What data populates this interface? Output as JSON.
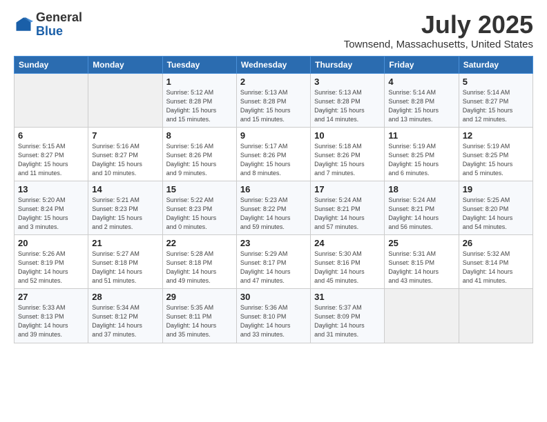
{
  "header": {
    "logo_general": "General",
    "logo_blue": "Blue",
    "month_year": "July 2025",
    "location": "Townsend, Massachusetts, United States"
  },
  "days_of_week": [
    "Sunday",
    "Monday",
    "Tuesday",
    "Wednesday",
    "Thursday",
    "Friday",
    "Saturday"
  ],
  "weeks": [
    [
      {
        "num": "",
        "info": ""
      },
      {
        "num": "",
        "info": ""
      },
      {
        "num": "1",
        "info": "Sunrise: 5:12 AM\nSunset: 8:28 PM\nDaylight: 15 hours\nand 15 minutes."
      },
      {
        "num": "2",
        "info": "Sunrise: 5:13 AM\nSunset: 8:28 PM\nDaylight: 15 hours\nand 15 minutes."
      },
      {
        "num": "3",
        "info": "Sunrise: 5:13 AM\nSunset: 8:28 PM\nDaylight: 15 hours\nand 14 minutes."
      },
      {
        "num": "4",
        "info": "Sunrise: 5:14 AM\nSunset: 8:28 PM\nDaylight: 15 hours\nand 13 minutes."
      },
      {
        "num": "5",
        "info": "Sunrise: 5:14 AM\nSunset: 8:27 PM\nDaylight: 15 hours\nand 12 minutes."
      }
    ],
    [
      {
        "num": "6",
        "info": "Sunrise: 5:15 AM\nSunset: 8:27 PM\nDaylight: 15 hours\nand 11 minutes."
      },
      {
        "num": "7",
        "info": "Sunrise: 5:16 AM\nSunset: 8:27 PM\nDaylight: 15 hours\nand 10 minutes."
      },
      {
        "num": "8",
        "info": "Sunrise: 5:16 AM\nSunset: 8:26 PM\nDaylight: 15 hours\nand 9 minutes."
      },
      {
        "num": "9",
        "info": "Sunrise: 5:17 AM\nSunset: 8:26 PM\nDaylight: 15 hours\nand 8 minutes."
      },
      {
        "num": "10",
        "info": "Sunrise: 5:18 AM\nSunset: 8:26 PM\nDaylight: 15 hours\nand 7 minutes."
      },
      {
        "num": "11",
        "info": "Sunrise: 5:19 AM\nSunset: 8:25 PM\nDaylight: 15 hours\nand 6 minutes."
      },
      {
        "num": "12",
        "info": "Sunrise: 5:19 AM\nSunset: 8:25 PM\nDaylight: 15 hours\nand 5 minutes."
      }
    ],
    [
      {
        "num": "13",
        "info": "Sunrise: 5:20 AM\nSunset: 8:24 PM\nDaylight: 15 hours\nand 3 minutes."
      },
      {
        "num": "14",
        "info": "Sunrise: 5:21 AM\nSunset: 8:23 PM\nDaylight: 15 hours\nand 2 minutes."
      },
      {
        "num": "15",
        "info": "Sunrise: 5:22 AM\nSunset: 8:23 PM\nDaylight: 15 hours\nand 0 minutes."
      },
      {
        "num": "16",
        "info": "Sunrise: 5:23 AM\nSunset: 8:22 PM\nDaylight: 14 hours\nand 59 minutes."
      },
      {
        "num": "17",
        "info": "Sunrise: 5:24 AM\nSunset: 8:21 PM\nDaylight: 14 hours\nand 57 minutes."
      },
      {
        "num": "18",
        "info": "Sunrise: 5:24 AM\nSunset: 8:21 PM\nDaylight: 14 hours\nand 56 minutes."
      },
      {
        "num": "19",
        "info": "Sunrise: 5:25 AM\nSunset: 8:20 PM\nDaylight: 14 hours\nand 54 minutes."
      }
    ],
    [
      {
        "num": "20",
        "info": "Sunrise: 5:26 AM\nSunset: 8:19 PM\nDaylight: 14 hours\nand 52 minutes."
      },
      {
        "num": "21",
        "info": "Sunrise: 5:27 AM\nSunset: 8:18 PM\nDaylight: 14 hours\nand 51 minutes."
      },
      {
        "num": "22",
        "info": "Sunrise: 5:28 AM\nSunset: 8:18 PM\nDaylight: 14 hours\nand 49 minutes."
      },
      {
        "num": "23",
        "info": "Sunrise: 5:29 AM\nSunset: 8:17 PM\nDaylight: 14 hours\nand 47 minutes."
      },
      {
        "num": "24",
        "info": "Sunrise: 5:30 AM\nSunset: 8:16 PM\nDaylight: 14 hours\nand 45 minutes."
      },
      {
        "num": "25",
        "info": "Sunrise: 5:31 AM\nSunset: 8:15 PM\nDaylight: 14 hours\nand 43 minutes."
      },
      {
        "num": "26",
        "info": "Sunrise: 5:32 AM\nSunset: 8:14 PM\nDaylight: 14 hours\nand 41 minutes."
      }
    ],
    [
      {
        "num": "27",
        "info": "Sunrise: 5:33 AM\nSunset: 8:13 PM\nDaylight: 14 hours\nand 39 minutes."
      },
      {
        "num": "28",
        "info": "Sunrise: 5:34 AM\nSunset: 8:12 PM\nDaylight: 14 hours\nand 37 minutes."
      },
      {
        "num": "29",
        "info": "Sunrise: 5:35 AM\nSunset: 8:11 PM\nDaylight: 14 hours\nand 35 minutes."
      },
      {
        "num": "30",
        "info": "Sunrise: 5:36 AM\nSunset: 8:10 PM\nDaylight: 14 hours\nand 33 minutes."
      },
      {
        "num": "31",
        "info": "Sunrise: 5:37 AM\nSunset: 8:09 PM\nDaylight: 14 hours\nand 31 minutes."
      },
      {
        "num": "",
        "info": ""
      },
      {
        "num": "",
        "info": ""
      }
    ]
  ]
}
